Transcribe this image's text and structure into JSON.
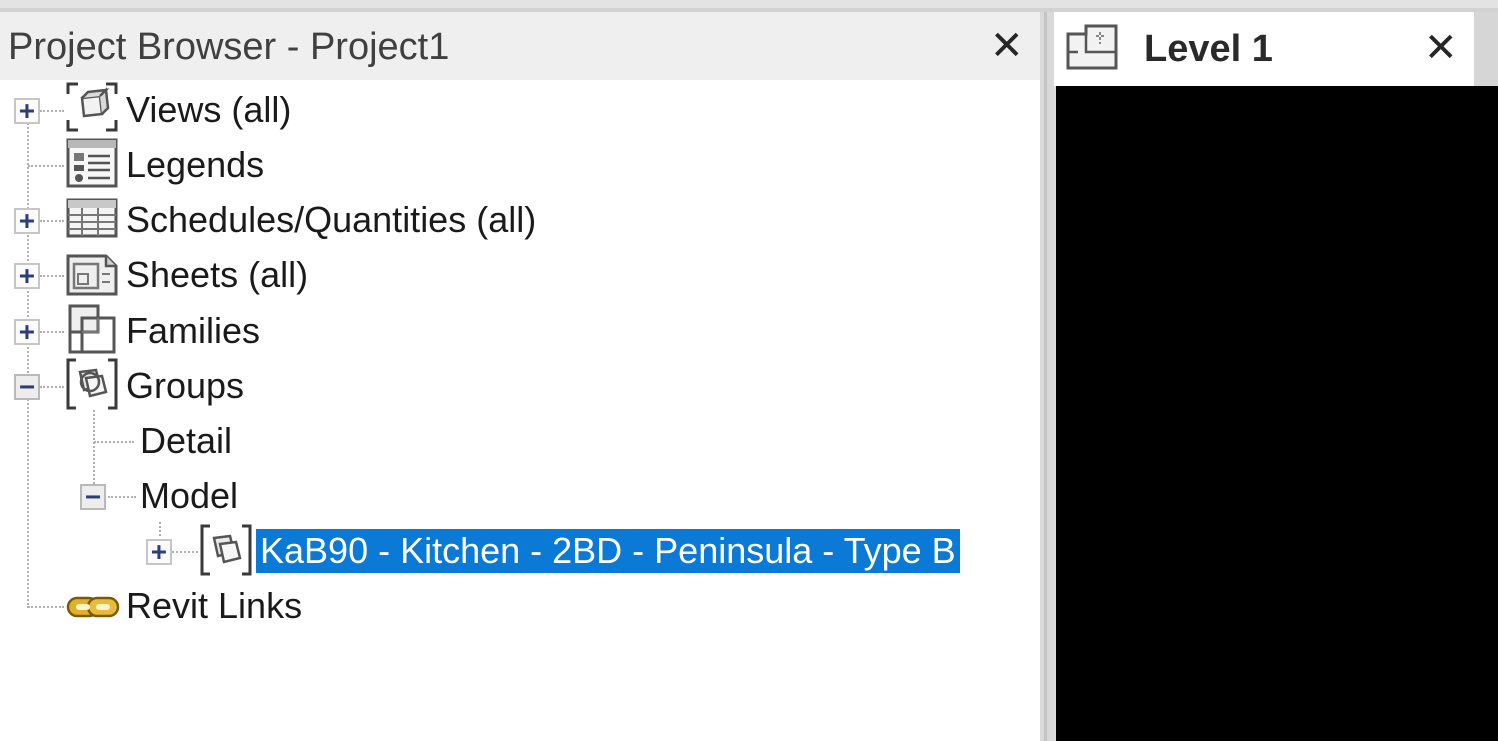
{
  "browser": {
    "title": "Project Browser - Project1",
    "close_label": "✕"
  },
  "view_tab": {
    "title": "Level 1",
    "close_label": "✕"
  },
  "tree": {
    "views": {
      "label": "Views (all)",
      "expander": "+"
    },
    "legends": {
      "label": "Legends"
    },
    "schedules": {
      "label": "Schedules/Quantities (all)",
      "expander": "+"
    },
    "sheets": {
      "label": "Sheets (all)",
      "expander": "+"
    },
    "families": {
      "label": "Families",
      "expander": "+"
    },
    "groups": {
      "label": "Groups",
      "expander": "−"
    },
    "detail": {
      "label": "Detail"
    },
    "model": {
      "label": "Model",
      "expander": "−"
    },
    "group_item": {
      "label": "KaB90 - Kitchen - 2BD - Peninsula - Type B",
      "expander": "+",
      "selected": true
    },
    "revit_links": {
      "label": "Revit Links"
    }
  },
  "colors": {
    "selection": "#0b79d6",
    "canvas": "#000000",
    "links_icon": "#d4a017"
  },
  "icons": {
    "views": "views-icon",
    "legends": "legends-icon",
    "schedules": "schedule-icon",
    "sheets": "sheet-icon",
    "families": "families-icon",
    "groups": "group-icon",
    "group_item": "group-icon",
    "revit_links": "link-icon",
    "view_tab": "floor-plan-icon"
  }
}
